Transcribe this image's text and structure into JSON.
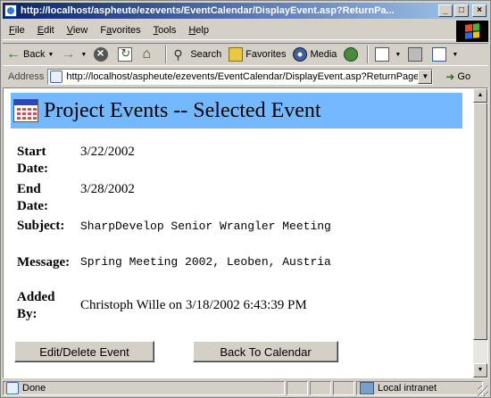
{
  "window": {
    "title": "http://localhost/aspheute/ezevents/EventCalendar/DisplayEvent.asp?ReturnPa...",
    "minimize": "_",
    "maximize": "□",
    "close": "×"
  },
  "menu": [
    {
      "key": "F",
      "rest": "ile"
    },
    {
      "key": "E",
      "rest": "dit"
    },
    {
      "key": "V",
      "rest": "iew"
    },
    {
      "key": "F",
      "rest": "avorites",
      "prefix": ""
    },
    {
      "key": "T",
      "rest": "ools"
    },
    {
      "key": "H",
      "rest": "elp"
    }
  ],
  "toolbar": {
    "back": "Back",
    "search": "Search",
    "favorites": "Favorites",
    "media": "Media"
  },
  "address": {
    "label": "Address",
    "url": "http://localhost/aspheute/ezevents/EventCalendar/DisplayEvent.asp?ReturnPage=",
    "go": "Go"
  },
  "page": {
    "banner_title": "Project Events -- Selected Event",
    "fields": {
      "start_label_1": "Start",
      "start_label_2": "Date:",
      "start_value": "3/22/2002",
      "end_label_1": "End",
      "end_label_2": "Date:",
      "end_value": "3/28/2002",
      "subject_label": "Subject:",
      "subject_value": "SharpDevelop Senior Wrangler Meeting",
      "message_label": "Message:",
      "message_value": "Spring Meeting 2002, Leoben, Austria",
      "added_label_1": "Added",
      "added_label_2": "By:",
      "added_value": "Christoph Wille on 3/18/2002 6:43:39 PM"
    },
    "buttons": {
      "edit": "Edit/Delete Event",
      "back": "Back To Calendar"
    }
  },
  "status": {
    "text": "Done",
    "zone": "Local intranet"
  },
  "colors": {
    "banner": "#74b8ff",
    "titlebar_start": "#0a246a",
    "titlebar_end": "#a6caf0"
  }
}
